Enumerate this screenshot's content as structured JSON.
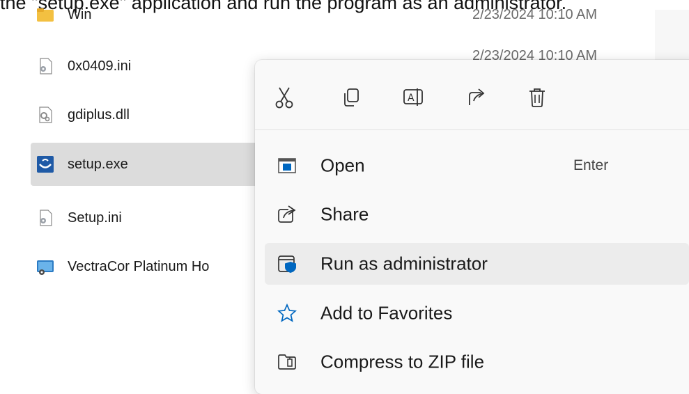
{
  "caption": "the \"setup.exe\" application and run the program as an administrator.",
  "files": [
    {
      "name": "Win",
      "date": "2/23/2024 10:10 AM",
      "icon": "folder-icon"
    },
    {
      "name": "0x0409.ini",
      "date": "2/23/2024 10:10 AM",
      "icon": "settings-file-icon"
    },
    {
      "name": "gdiplus.dll",
      "date": "",
      "icon": "dll-file-icon"
    },
    {
      "name": "setup.exe",
      "date": "",
      "icon": "setup-exe-icon",
      "selected": true
    },
    {
      "name": "Setup.ini",
      "date": "",
      "icon": "settings-file-icon"
    },
    {
      "name": "VectraCor Platinum Ho",
      "date": "",
      "icon": "installer-package-icon"
    }
  ],
  "context_menu": {
    "toolbar": [
      "cut-icon",
      "copy-icon",
      "rename-icon",
      "share-icon",
      "delete-icon"
    ],
    "items": [
      {
        "label": "Open",
        "shortcut": "Enter",
        "icon": "open-window-icon"
      },
      {
        "label": "Share",
        "shortcut": "",
        "icon": "share-icon"
      },
      {
        "label": "Run as administrator",
        "shortcut": "",
        "icon": "shield-icon",
        "highlighted": true
      },
      {
        "label": "Add to Favorites",
        "shortcut": "",
        "icon": "star-icon"
      },
      {
        "label": "Compress to ZIP file",
        "shortcut": "",
        "icon": "zip-icon"
      }
    ]
  },
  "colors": {
    "accent": "#0067c0",
    "selection": "#dcdcdc",
    "menu_bg": "#f9f9f9",
    "highlight": "#ececec"
  }
}
